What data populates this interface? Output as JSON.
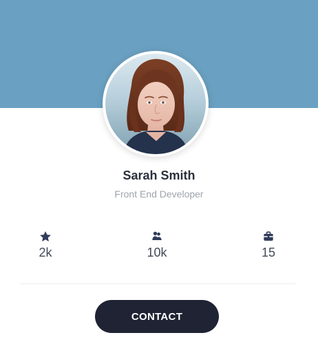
{
  "profile": {
    "name": "Sarah Smith",
    "role": "Front End Developer"
  },
  "stats": [
    {
      "icon": "star-icon",
      "value": "2k"
    },
    {
      "icon": "users-icon",
      "value": "10k"
    },
    {
      "icon": "briefcase-icon",
      "value": "15"
    }
  ],
  "actions": {
    "contact_label": "CONTACT"
  },
  "colors": {
    "cover": "#6aa0c1",
    "button": "#1f2333",
    "name_text": "#2b2f3a",
    "role_text": "#9ea3aa"
  }
}
